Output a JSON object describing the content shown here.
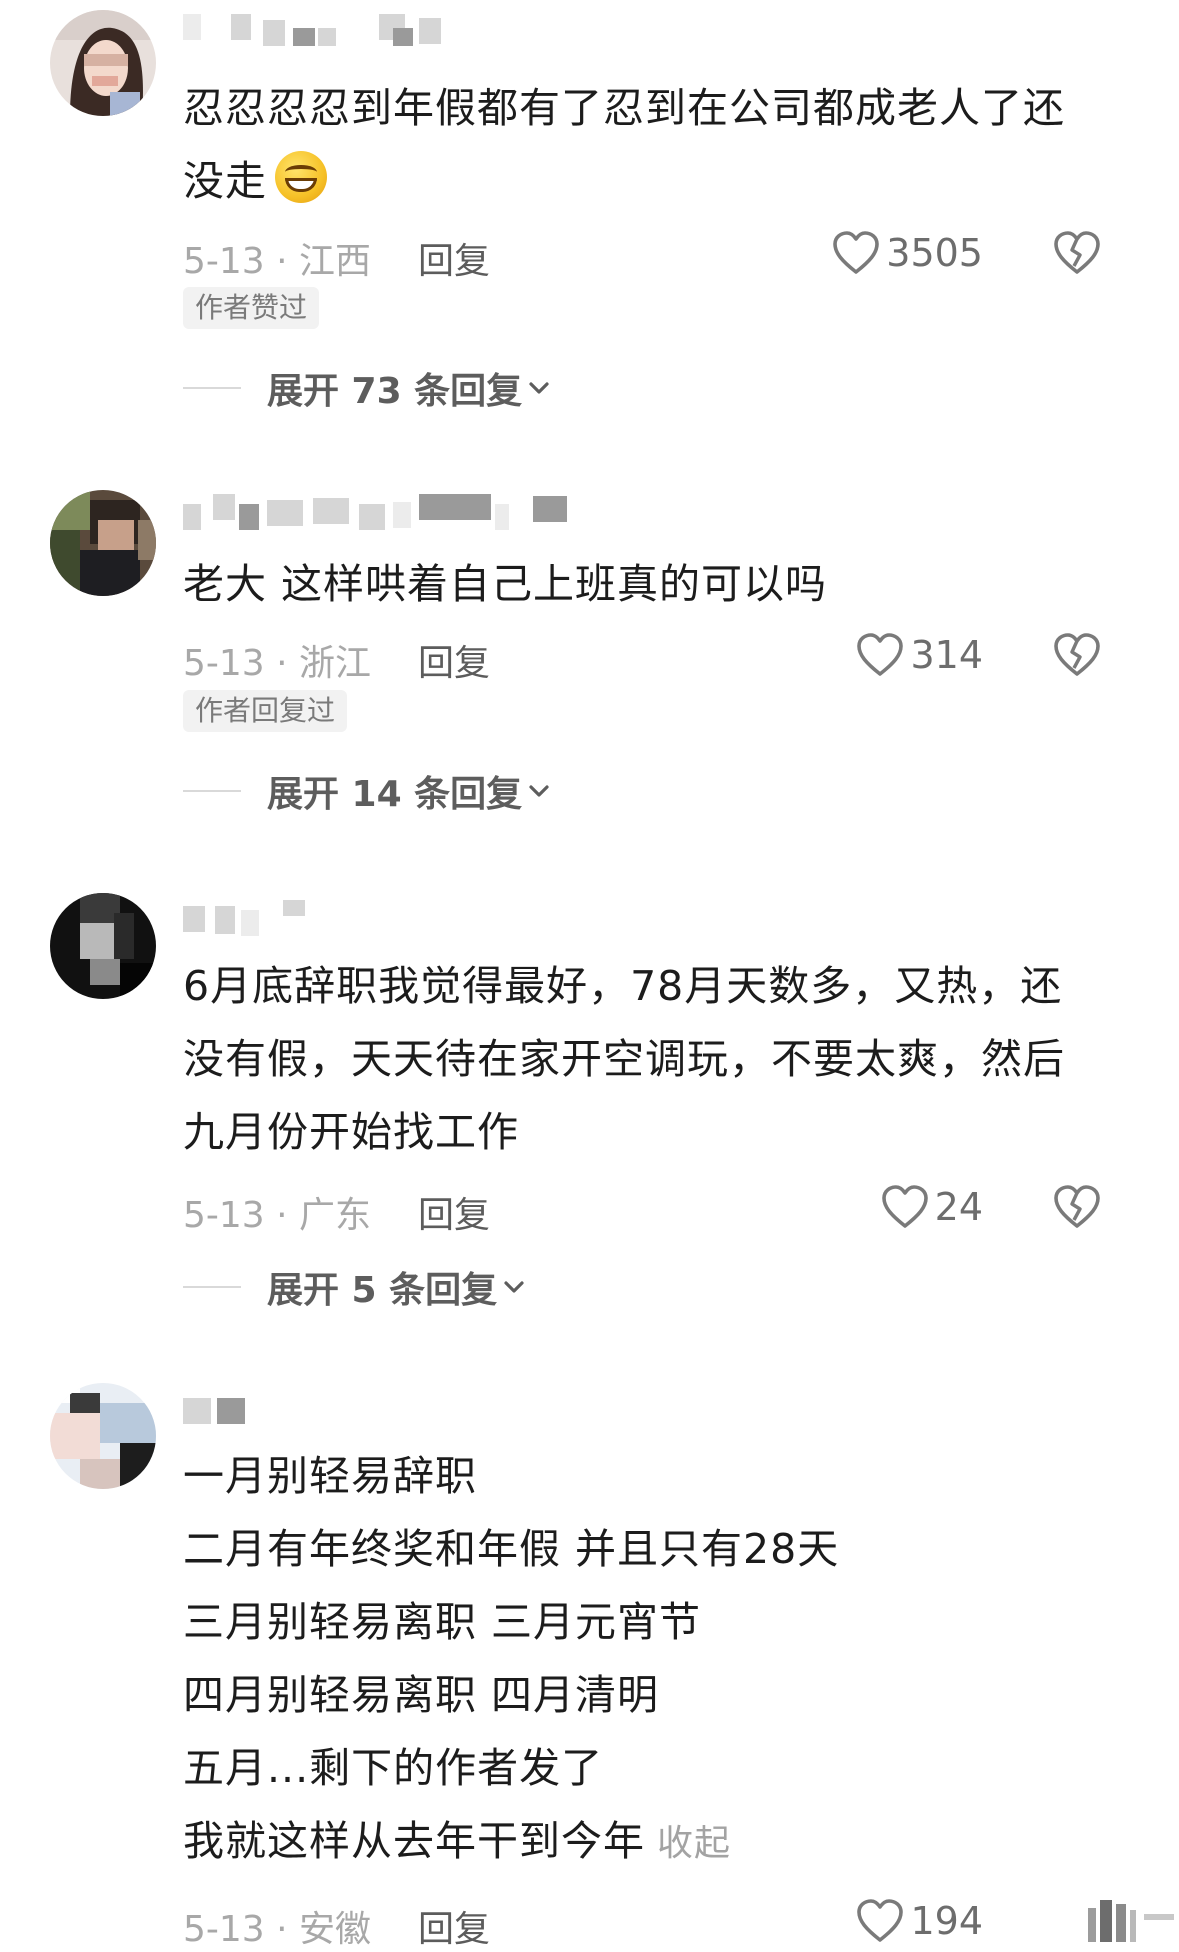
{
  "colors": {
    "text": "#1c1c1c",
    "meta": "#a8a8a8",
    "reply": "#5c5c5c",
    "badge_bg": "#f2f2f2",
    "badge_text": "#7a7a7a",
    "heart_stroke": "#7a7a7a"
  },
  "comments": [
    {
      "lines": [
        "忍忍忍忍到年假都有了忍到在公司都成老人了还",
        "没走"
      ],
      "emoji": "grinning-face-icon",
      "date_location": "5-13 · 江西",
      "reply_label": "回复",
      "like_count": "3505",
      "badge": "作者赞过",
      "expand_label": "展开 73 条回复"
    },
    {
      "lines": [
        "老大 这样哄着自己上班真的可以吗"
      ],
      "date_location": "5-13 · 浙江",
      "reply_label": "回复",
      "like_count": "314",
      "badge": "作者回复过",
      "expand_label": "展开 14 条回复"
    },
    {
      "lines": [
        "6月底辞职我觉得最好，78月天数多，又热，还",
        "没有假，天天待在家开空调玩，不要太爽，然后",
        "九月份开始找工作"
      ],
      "date_location": "5-13 · 广东",
      "reply_label": "回复",
      "like_count": "24",
      "expand_label": "展开 5 条回复"
    },
    {
      "lines": [
        "一月别轻易辞职",
        "二月有年终奖和年假 并且只有28天",
        "三月别轻易离职 三月元宵节",
        "四月别轻易离职 四月清明",
        "五月...剩下的作者发了",
        "我就这样从去年干到今年"
      ],
      "collapse_label": "收起",
      "date_location": "5-13 · 安徽",
      "reply_label": "回复",
      "like_count": "194"
    }
  ]
}
